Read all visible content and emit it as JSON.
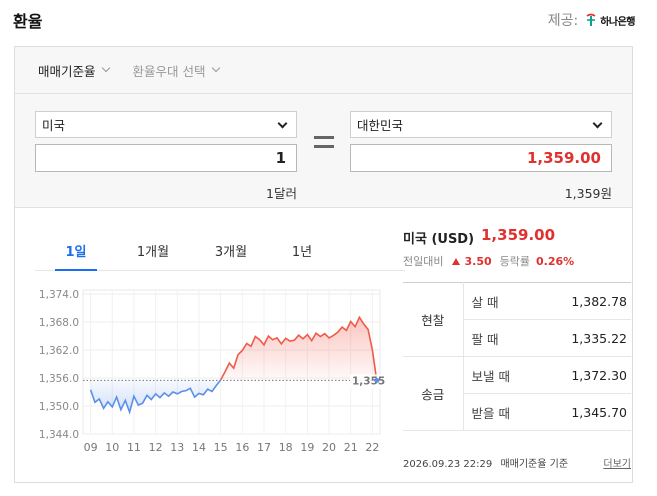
{
  "header": {
    "title": "환율",
    "provider_label": "제공:",
    "provider_logo_text": "하나은행"
  },
  "calc": {
    "rate_type_tabs": [
      {
        "label": "매매기준율",
        "active": true
      },
      {
        "label": "환율우대 선택",
        "active": false
      }
    ],
    "from": {
      "country": "미국",
      "amount": "1",
      "unit": "1달러"
    },
    "to": {
      "country": "대한민국",
      "amount": "1,359.00",
      "unit": "1,359원"
    },
    "accent_red": "#e0312f"
  },
  "chart": {
    "tabs": [
      {
        "label": "1일",
        "active": true
      },
      {
        "label": "1개월",
        "active": false
      },
      {
        "label": "3개월",
        "active": false
      },
      {
        "label": "1년",
        "active": false
      }
    ],
    "reference_label": "1,355.5"
  },
  "chart_data": {
    "type": "line",
    "y_ticks": [
      "1,374.0",
      "1,368.0",
      "1,362.0",
      "1,356.0",
      "1,350.0",
      "1,344.0"
    ],
    "x_ticks": [
      "09",
      "10",
      "11",
      "12",
      "13",
      "14",
      "15",
      "16",
      "17",
      "18",
      "19",
      "20",
      "21",
      "22"
    ],
    "ylim": [
      1344,
      1374
    ],
    "reference_value": 1355.5,
    "below_color": "#5b8fe8",
    "above_color": "#f05a4a",
    "x": [
      9.0,
      9.2,
      9.4,
      9.6,
      9.8,
      10.0,
      10.2,
      10.4,
      10.6,
      10.8,
      11.0,
      11.2,
      11.4,
      11.6,
      11.8,
      12.0,
      12.2,
      12.4,
      12.6,
      12.8,
      13.0,
      13.2,
      13.4,
      13.6,
      13.8,
      14.0,
      14.2,
      14.4,
      14.6,
      14.8,
      15.0,
      15.2,
      15.4,
      15.6,
      15.8,
      16.0,
      16.2,
      16.4,
      16.6,
      16.8,
      17.0,
      17.2,
      17.4,
      17.6,
      17.8,
      18.0,
      18.2,
      18.4,
      18.6,
      18.8,
      19.0,
      19.2,
      19.4,
      19.6,
      19.8,
      20.0,
      20.2,
      20.4,
      20.6,
      20.8,
      21.0,
      21.2,
      21.4,
      21.6,
      21.8,
      22.0,
      22.2
    ],
    "y": [
      1353.5,
      1350.8,
      1351.5,
      1349.5,
      1350.9,
      1349.8,
      1351.9,
      1349.2,
      1351.2,
      1348.7,
      1352.1,
      1350.2,
      1350.6,
      1352.3,
      1351.4,
      1352.6,
      1351.8,
      1352.8,
      1352.1,
      1353.0,
      1352.6,
      1353.1,
      1353.3,
      1353.8,
      1351.9,
      1352.7,
      1352.4,
      1353.6,
      1353.1,
      1354.4,
      1355.6,
      1357.3,
      1359.2,
      1358.1,
      1361.0,
      1361.9,
      1363.4,
      1362.8,
      1364.9,
      1364.2,
      1363.1,
      1365.0,
      1364.2,
      1364.6,
      1363.3,
      1364.5,
      1363.9,
      1364.1,
      1365.2,
      1364.4,
      1365.3,
      1364.0,
      1365.6,
      1364.9,
      1365.5,
      1364.6,
      1365.1,
      1365.8,
      1366.9,
      1366.2,
      1368.1,
      1367.0,
      1369.0,
      1367.6,
      1366.4,
      1362.0,
      1355.5
    ]
  },
  "info": {
    "title": "미국 (USD)",
    "rate": "1,359.00",
    "change_label": "전일대비",
    "change_value": "3.50",
    "change_rate_label": "등락률",
    "change_rate": "0.26%",
    "rows": [
      {
        "group": "현찰",
        "label": "살 때",
        "value": "1,382.78"
      },
      {
        "group": "현찰",
        "label": "팔 때",
        "value": "1,335.22"
      },
      {
        "group": "송금",
        "label": "보낼 때",
        "value": "1,372.30"
      },
      {
        "group": "송금",
        "label": "받을 때",
        "value": "1,345.70"
      }
    ],
    "timestamp": "2026.09.23 22:29",
    "basis": "매매기준율 기준",
    "more_label": "더보기"
  }
}
